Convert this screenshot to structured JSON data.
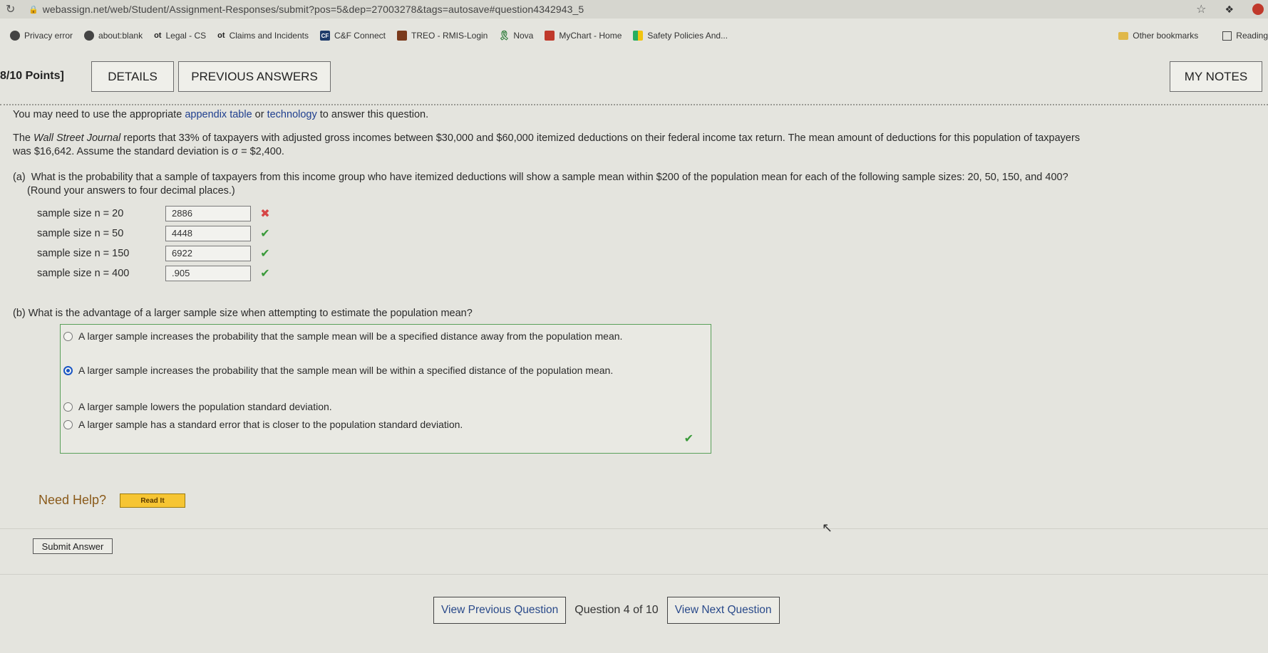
{
  "browser": {
    "url": "webassign.net/web/Student/Assignment-Responses/submit?pos=5&dep=27003278&tags=autosave#question4342943_5",
    "bookmarks": [
      "Privacy error",
      "about:blank",
      "Legal - CS",
      "Claims and Incidents",
      "C&F Connect",
      "TREO - RMIS-Login",
      "Nova",
      "MyChart - Home",
      "Safety Policies And..."
    ],
    "other_bookmarks": "Other bookmarks",
    "reading_list": "Reading"
  },
  "header": {
    "points": "8/10 Points]",
    "details": "DETAILS",
    "previous_answers": "PREVIOUS ANSWERS",
    "my_notes": "MY NOTES"
  },
  "question": {
    "note_prefix": "You may need to use the appropriate ",
    "note_link1": "appendix table",
    "note_mid": " or ",
    "note_link2": "technology",
    "note_suffix": " to answer this question.",
    "statement_line1_pre": "The ",
    "statement_journal": "Wall Street Journal",
    "statement_line1_post": " reports that 33% of taxpayers with adjusted gross incomes between $30,000 and $60,000 itemized deductions on their federal income tax return. The mean amount of deductions for this population of taxpayers",
    "statement_line2": "was $16,642. Assume the standard deviation is σ = $2,400.",
    "part_a_label": "(a)",
    "part_a_text": "What is the probability that a sample of taxpayers from this income group who have itemized deductions will show a sample mean within $200 of the population mean for each of the following sample sizes: 20, 50, 150, and 400?",
    "part_a_sub": "(Round your answers to four decimal places.)",
    "rows": [
      {
        "label": "sample size n = 20",
        "value": "2886",
        "status": "wrong"
      },
      {
        "label": "sample size n = 50",
        "value": "4448",
        "status": "correct"
      },
      {
        "label": "sample size n = 150",
        "value": "6922",
        "status": "correct"
      },
      {
        "label": "sample size n = 400",
        "value": ".905",
        "status": "correct"
      }
    ],
    "part_b": "(b)  What is the advantage of a larger sample size when attempting to estimate the population mean?",
    "choices": [
      {
        "text": "A larger sample increases the probability that the sample mean will be a specified distance away from the population mean.",
        "selected": false
      },
      {
        "text": "A larger sample increases the probability that the sample mean will be within a specified distance of the population mean.",
        "selected": true
      },
      {
        "text": "A larger sample lowers the population standard deviation.",
        "selected": false
      },
      {
        "text": "A larger sample has a standard error that is closer to the population standard deviation.",
        "selected": false
      }
    ]
  },
  "help": {
    "need_help": "Need Help?",
    "read_it": "Read It"
  },
  "submit_answer": "Submit Answer",
  "nav": {
    "prev": "View Previous Question",
    "label": "Question 4 of 10",
    "next": "View Next Question"
  },
  "icons": {
    "wrong": "✖",
    "correct": "✔"
  }
}
